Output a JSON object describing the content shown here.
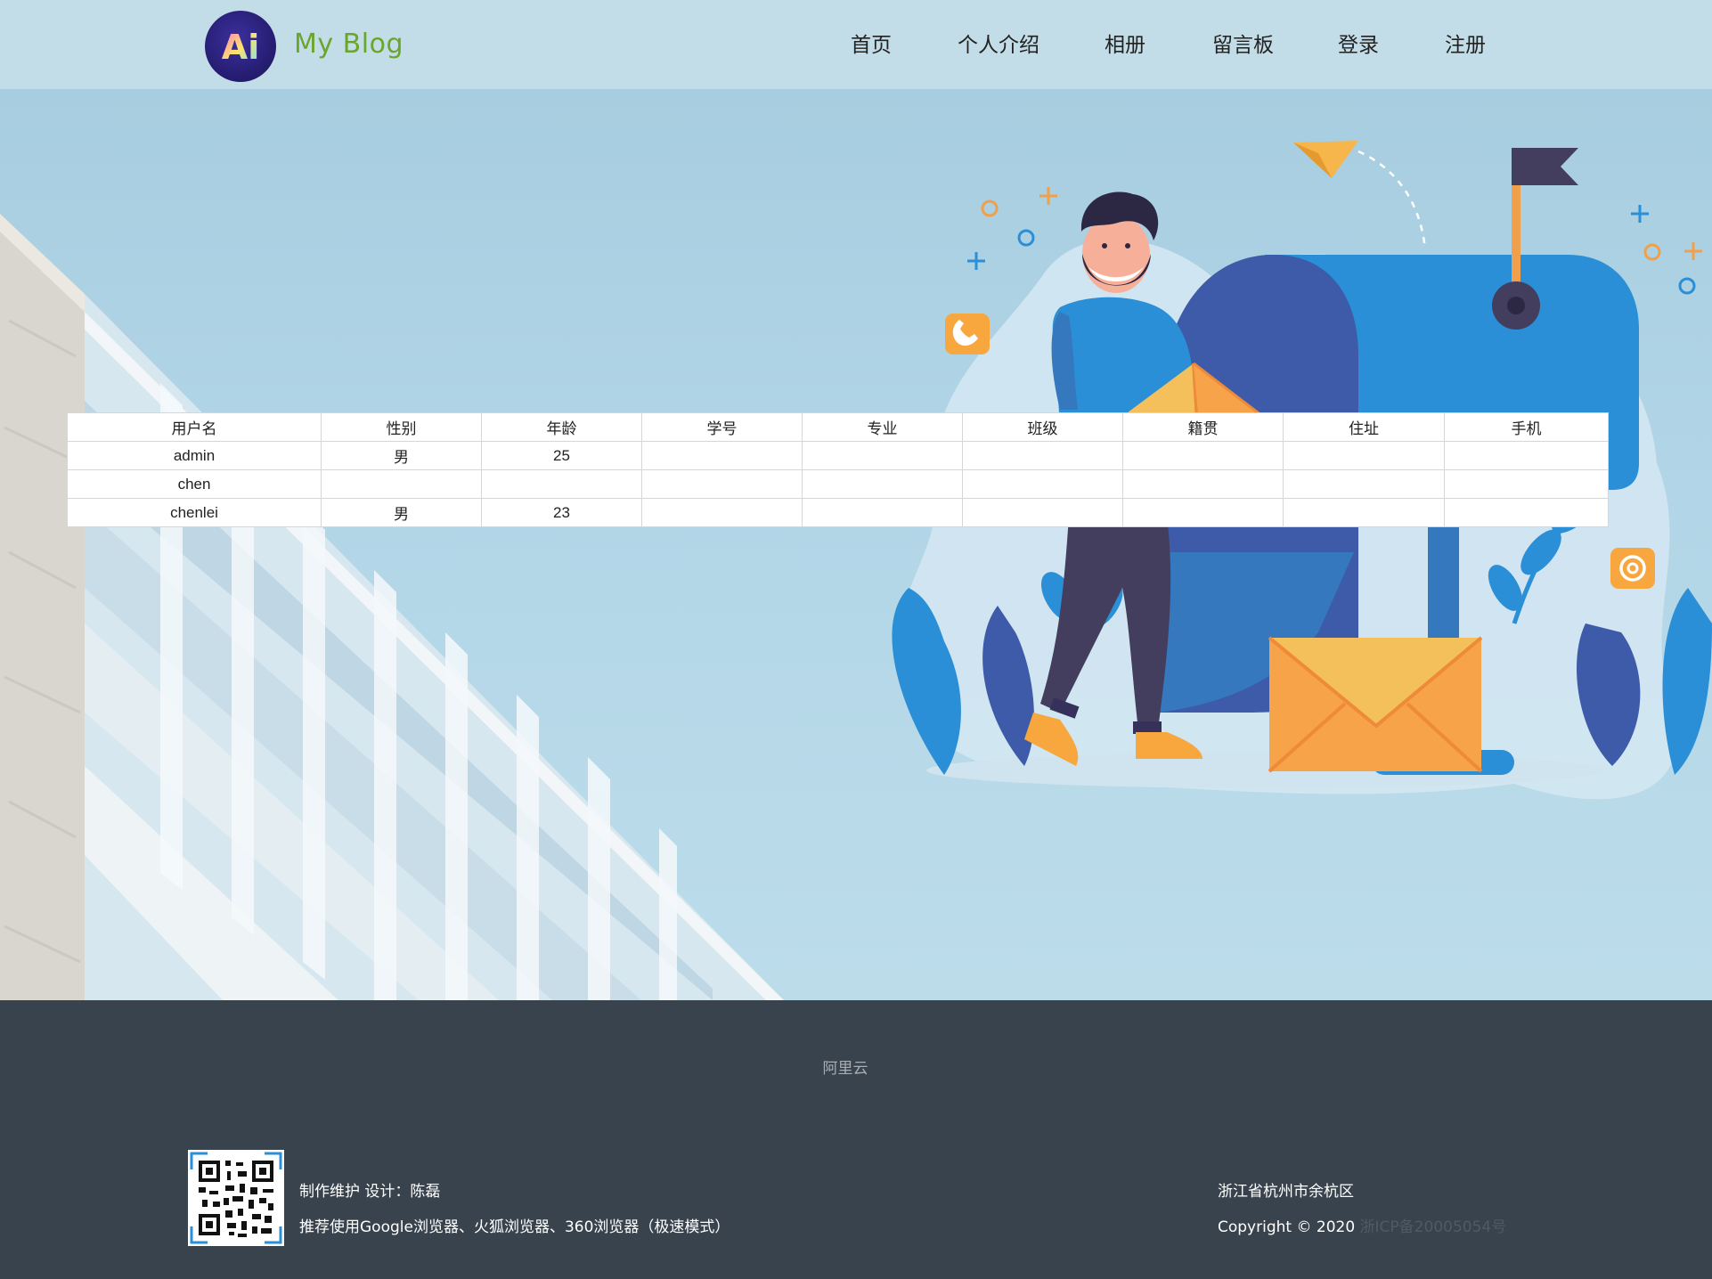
{
  "header": {
    "logo_letters": "Ai",
    "brand": "My Blog",
    "nav": [
      "首页",
      "个人介绍",
      "相册",
      "留言板",
      "登录",
      "注册"
    ]
  },
  "table": {
    "columns": [
      "用户名",
      "性别",
      "年龄",
      "学号",
      "专业",
      "班级",
      "籍贯",
      "住址",
      "手机"
    ],
    "rows": [
      [
        "admin",
        "男",
        "25",
        "",
        "",
        "",
        "",
        "",
        ""
      ],
      [
        "chen",
        "",
        "",
        "",
        "",
        "",
        "",
        "",
        ""
      ],
      [
        "chenlei",
        "男",
        "23",
        "",
        "",
        "",
        "",
        "",
        ""
      ]
    ]
  },
  "footer": {
    "link": "阿里云",
    "maintainer": "制作维护 设计：陈磊",
    "browsers": "推荐使用Google浏览器、火狐浏览器、360浏览器（极速模式）",
    "address": "浙江省杭州市余杭区",
    "copyright": "Copyright © 2020",
    "icp": "浙ICP备20005054号"
  },
  "icons": {
    "phone": "phone-icon",
    "at": "at-sign-icon",
    "flag": "flag-icon",
    "paper_plane": "paper-plane-icon"
  },
  "colors": {
    "header_bg": "#c3dde8",
    "brand_green": "#6aa52c",
    "footer_bg": "#39434d",
    "accent_orange": "#f7a73e",
    "accent_blue": "#2a8fd6"
  }
}
